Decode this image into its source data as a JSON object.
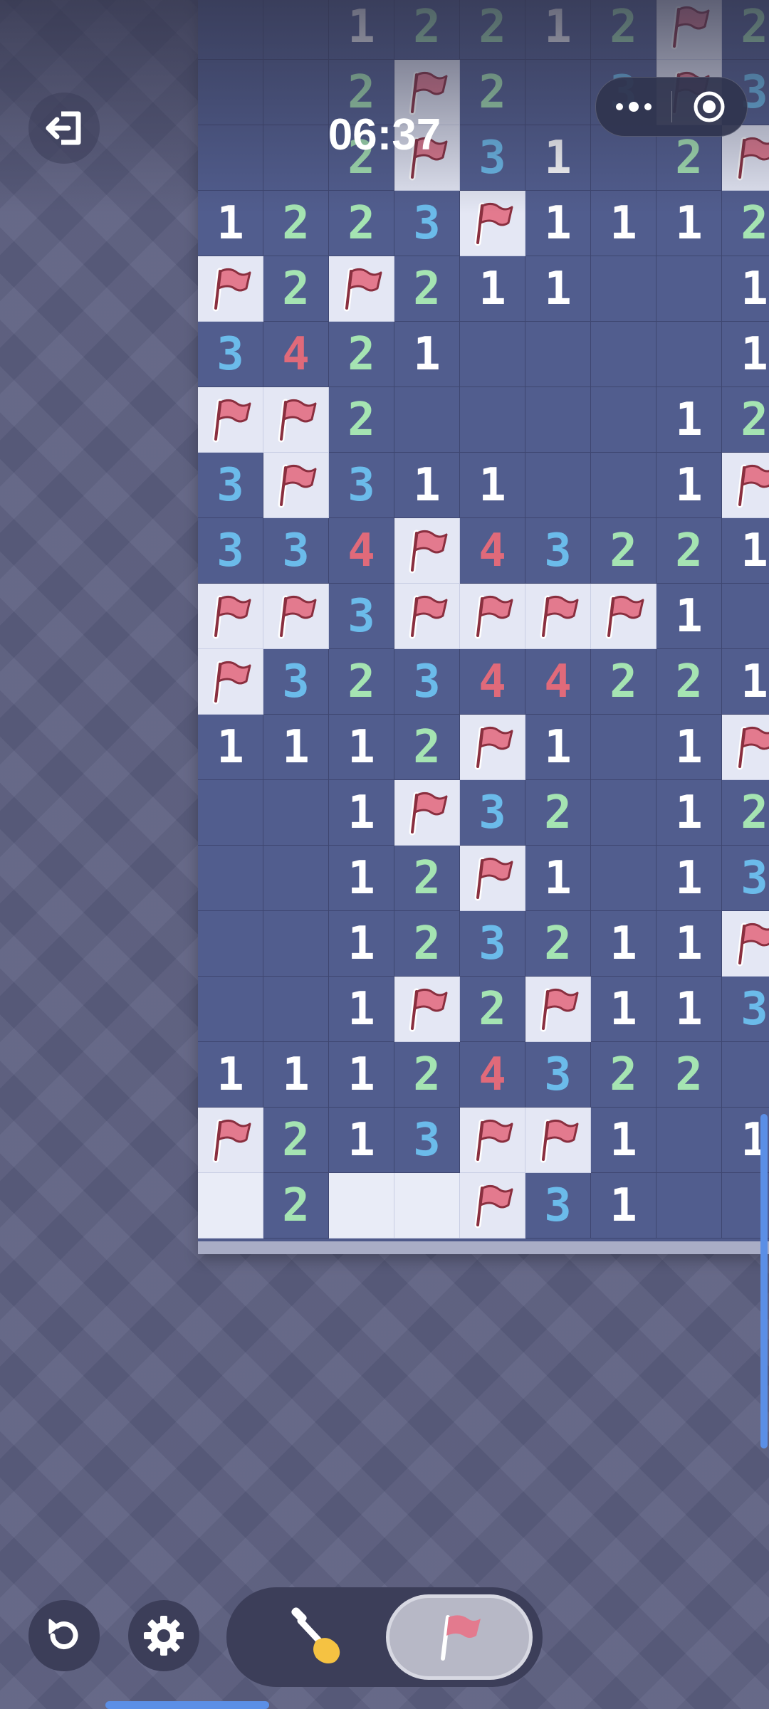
{
  "hud": {
    "timer": "06:37",
    "exit_icon": "exit-icon",
    "menu_icon": "more-dots-icon",
    "close_icon": "target-close-icon"
  },
  "tools": {
    "restart_icon": "restart-icon",
    "settings_icon": "gear-icon",
    "dig_icon": "shovel-icon",
    "flag_icon": "flag-icon",
    "active_tool": "flag"
  },
  "colors": {
    "number_1": "#ffffff",
    "number_2": "#a5e4b2",
    "number_3": "#6bbbea",
    "number_4": "#e06a7a",
    "flag": "#e37a8e",
    "board": "#515d8e",
    "unrevealed": "#e9ecf7",
    "accent": "#5b8fe6"
  },
  "legend": "rows of cells: '.' = revealed empty, digit = number, 'F' = flagged, 'U' = unrevealed",
  "board": {
    "columns": 9,
    "rows": [
      "..12212F2",
      "..2F2.3F3",
      "..2F31.2F3",
      "1223F1112",
      "F2F211..1",
      "3421....1",
      "FF2....12",
      "3F311..1F",
      "334F43221",
      "FF3FFFF1.",
      "F3234422 1",
      "1112F1.1F",
      "..1F32.12",
      "..12F1.13",
      "..12321 1F",
      "..1F2F113",
      "11124322.1",
      "F213FF1.1",
      "U2UUF31.."
    ]
  }
}
